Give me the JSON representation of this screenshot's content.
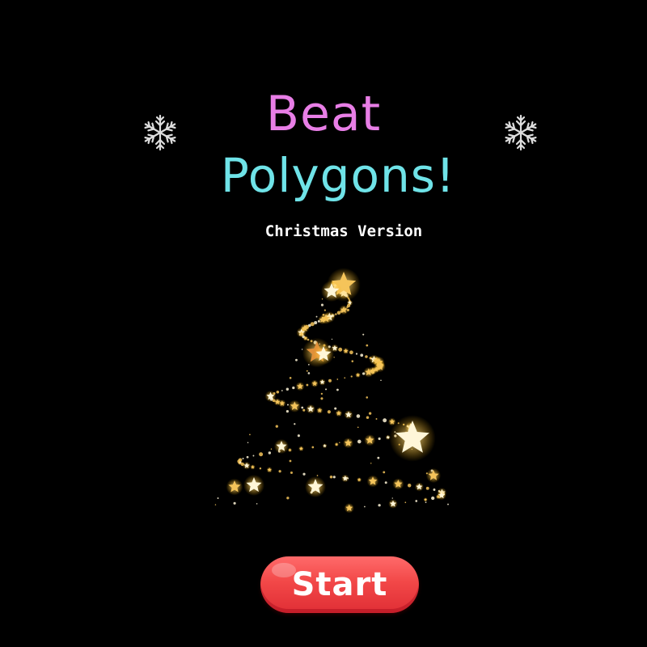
{
  "title": {
    "line1": "Beat",
    "line2": "Polygons!",
    "line1_color": "#e87ee6",
    "line2_color": "#6fe3e8"
  },
  "subtitle": "Christmas Version",
  "subtitle_color": "#ffffff",
  "icons": {
    "left": "snowflake-icon",
    "right": "snowflake-icon",
    "center": "christmas-tree-of-stars"
  },
  "start_button": {
    "label": "Start",
    "color": "#f24848"
  },
  "colors": {
    "background": "#000000",
    "star_gold": "#f5c45a",
    "star_white": "#fff6d8",
    "snowflake": "#dddddd"
  }
}
